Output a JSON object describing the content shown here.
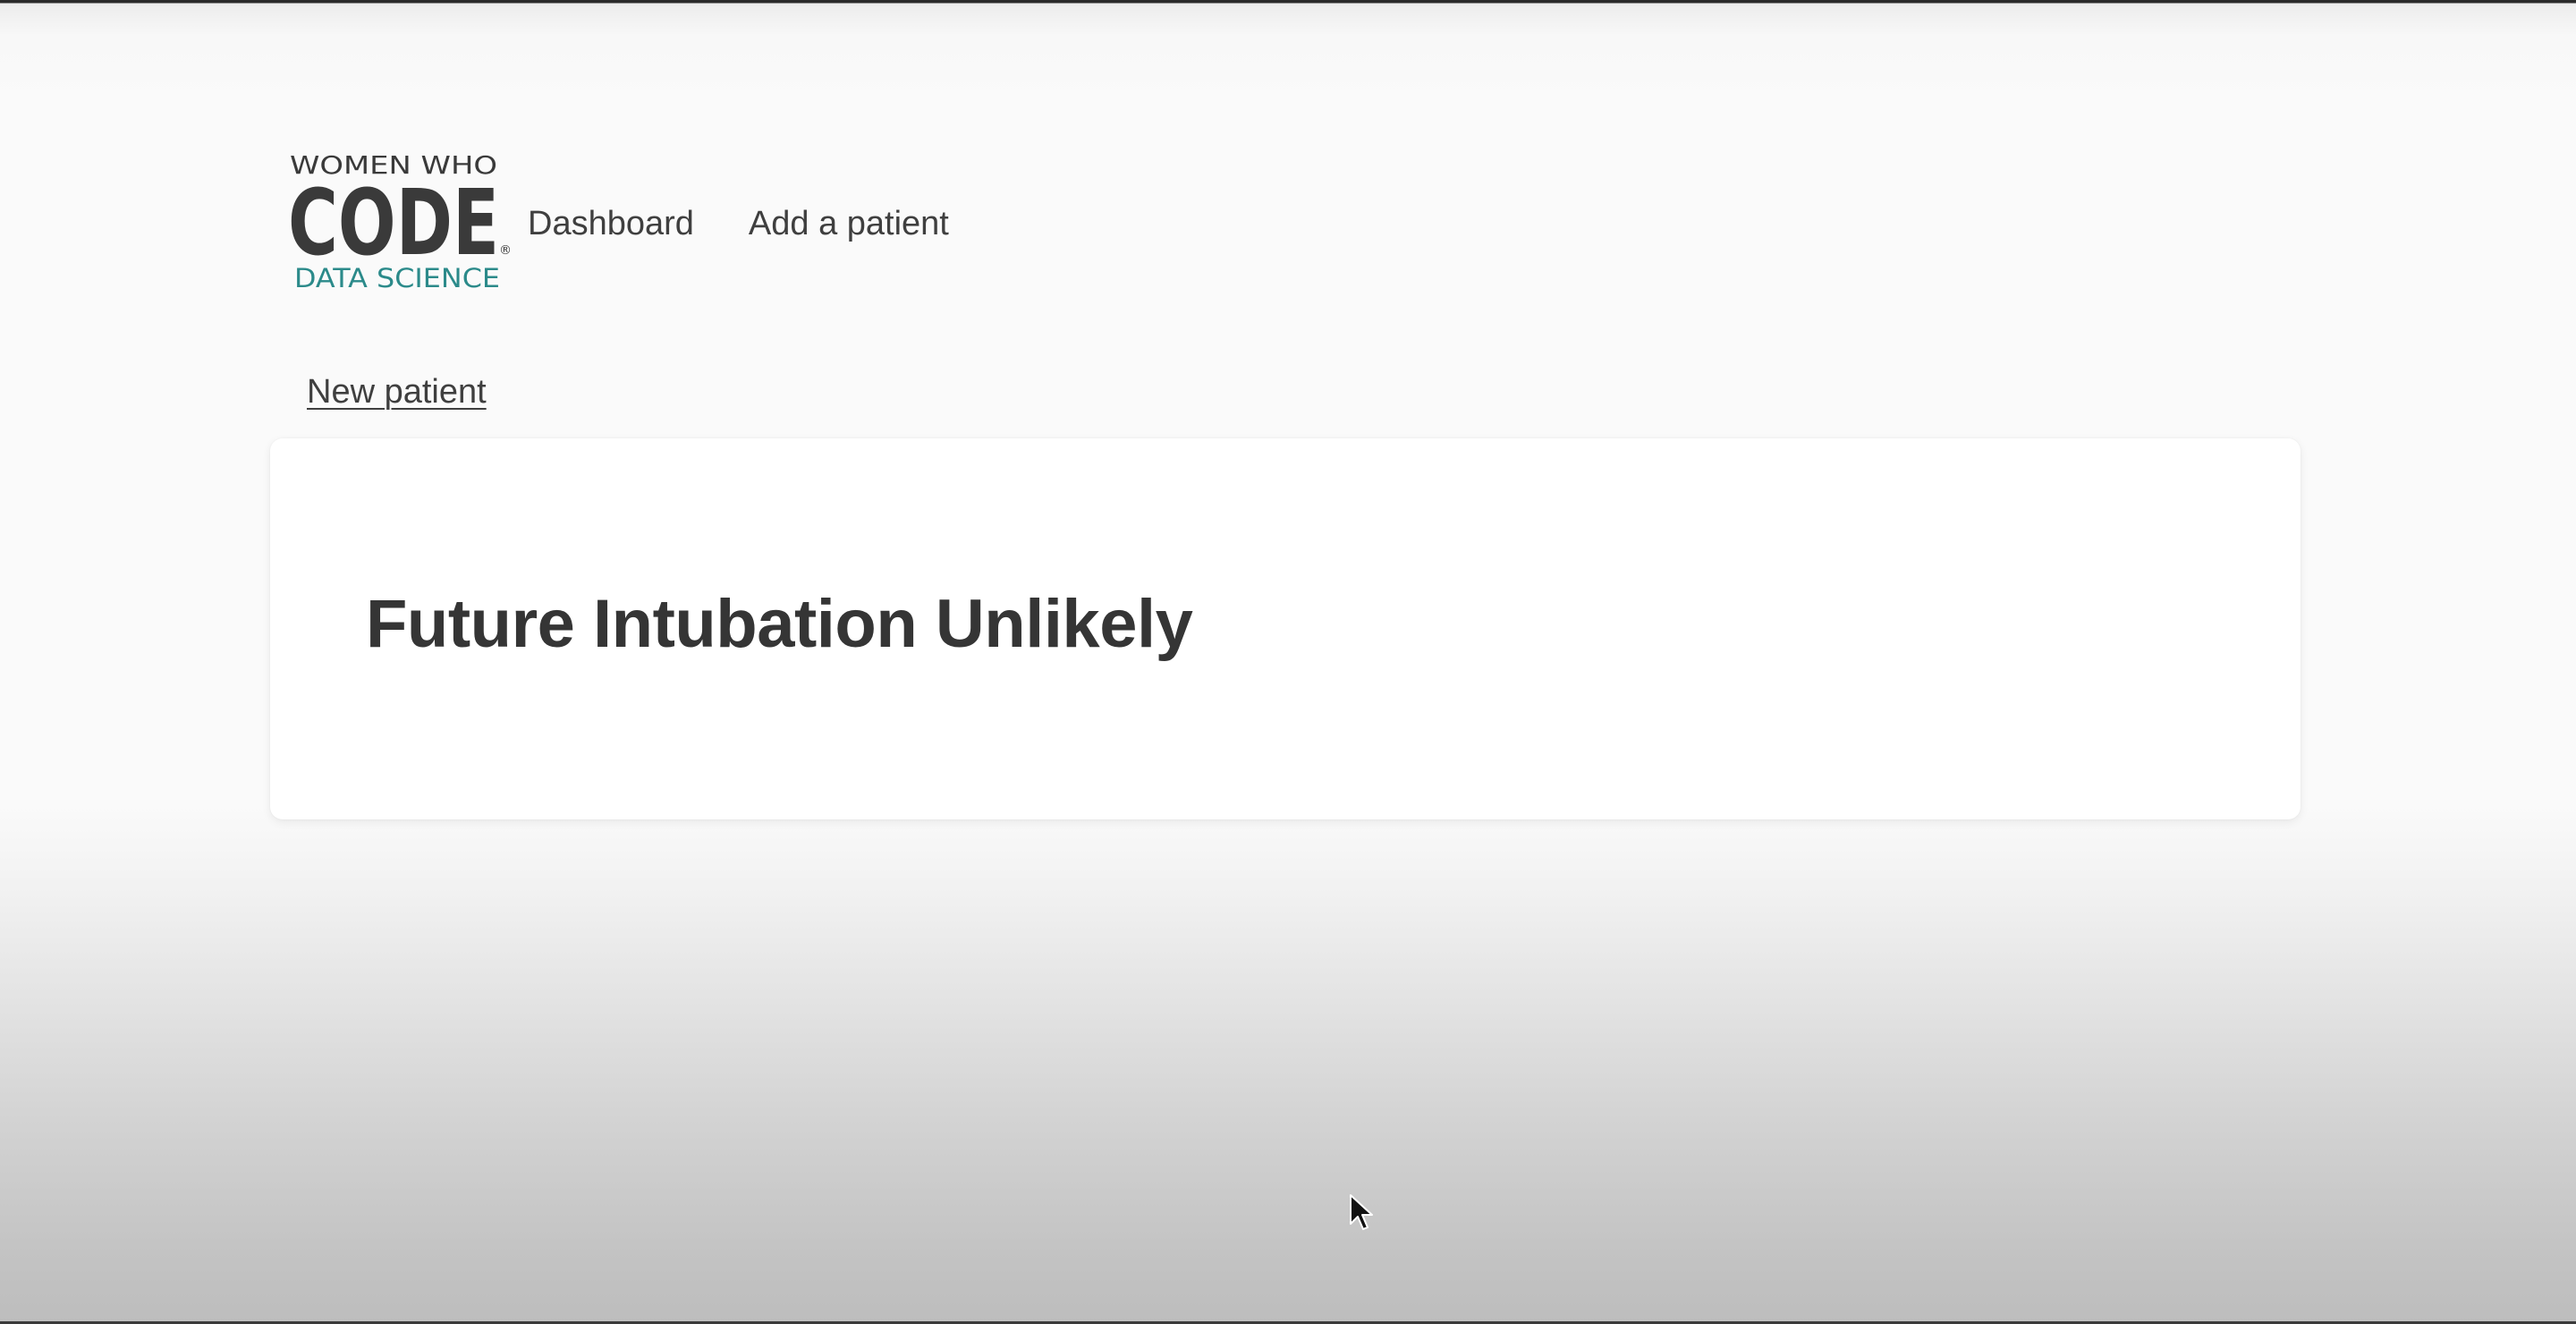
{
  "logo": {
    "line1": "WOMEN WHO",
    "line2": "CODE",
    "line3": "DATA SCIENCE",
    "mark": "®",
    "colors": {
      "dark": "#3a3a3a",
      "teal": "#2b8a8a"
    }
  },
  "nav": {
    "dashboard": "Dashboard",
    "add_patient": "Add a patient"
  },
  "links": {
    "new_patient": "New patient"
  },
  "result": {
    "title": "Future Intubation Unlikely"
  },
  "icons": {
    "cursor": "mouse-pointer-icon"
  }
}
